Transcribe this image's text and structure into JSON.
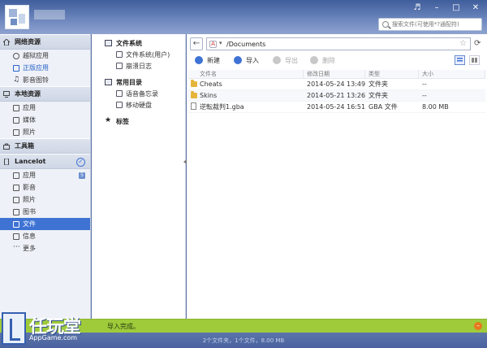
{
  "header": {
    "search_placeholder": "搜索文件(可使用*?通配符)",
    "window_controls": [
      "♬",
      "–",
      "□",
      "✕"
    ]
  },
  "sidebar": {
    "sections": [
      {
        "title": "网络资源",
        "icon": "home-icon",
        "items": [
          {
            "label": "越狱应用",
            "icon": "jailbreak-app-icon"
          },
          {
            "label": "正版应用",
            "icon": "store-app-icon"
          },
          {
            "label": "影音图铃",
            "icon": "music-icon"
          }
        ]
      },
      {
        "title": "本地资源",
        "icon": "computer-icon",
        "items": [
          {
            "label": "应用",
            "icon": "apps-icon"
          },
          {
            "label": "媒体",
            "icon": "media-icon"
          },
          {
            "label": "照片",
            "icon": "photo-icon"
          }
        ]
      },
      {
        "title": "工具箱",
        "icon": "toolbox-icon",
        "items": []
      },
      {
        "title": "Lancelot",
        "icon": "phone-icon",
        "items": [
          {
            "label": "应用",
            "icon": "apps-icon",
            "badge": "5"
          },
          {
            "label": "影音",
            "icon": "video-icon"
          },
          {
            "label": "照片",
            "icon": "photo-icon"
          },
          {
            "label": "图书",
            "icon": "book-icon"
          },
          {
            "label": "文件",
            "icon": "file-icon"
          },
          {
            "label": "信息",
            "icon": "message-icon"
          },
          {
            "label": "更多",
            "icon": "more-icon"
          }
        ]
      }
    ]
  },
  "tree": {
    "groups": [
      {
        "title": "文件系统",
        "items": [
          "文件系统(用户)",
          "崩溃日志"
        ]
      },
      {
        "title": "常用目录",
        "items": [
          "语音备忘录",
          "移动硬盘"
        ]
      },
      {
        "title": "标签",
        "items": []
      }
    ]
  },
  "address": {
    "path": "/Documents"
  },
  "toolbar": {
    "new": "新建",
    "import": "导入",
    "export": "导出",
    "delete": "删除"
  },
  "table": {
    "columns": [
      "文件名",
      "修改日期",
      "类型",
      "大小"
    ],
    "rows": [
      {
        "name": "Cheats",
        "date": "2014-05-24 13:49",
        "type": "文件夹",
        "size": "--"
      },
      {
        "name": "Skins",
        "date": "2014-05-21 13:26",
        "type": "文件夹",
        "size": "--"
      },
      {
        "name": "逆転裁判1.gba",
        "date": "2014-05-24 16:51",
        "type": "GBA 文件",
        "size": "8.00 MB"
      }
    ]
  },
  "notice": {
    "text": "导入完成。"
  },
  "status": {
    "text": "2个文件夹，1个文件，8.00 MB"
  },
  "watermark": {
    "cn": "任玩堂",
    "en": "AppGame.com"
  },
  "colors": {
    "accent": "#3e73d4",
    "notice": "#9fcb3b",
    "folder": "#e5b53a",
    "topbar": "#4f6aa6"
  }
}
